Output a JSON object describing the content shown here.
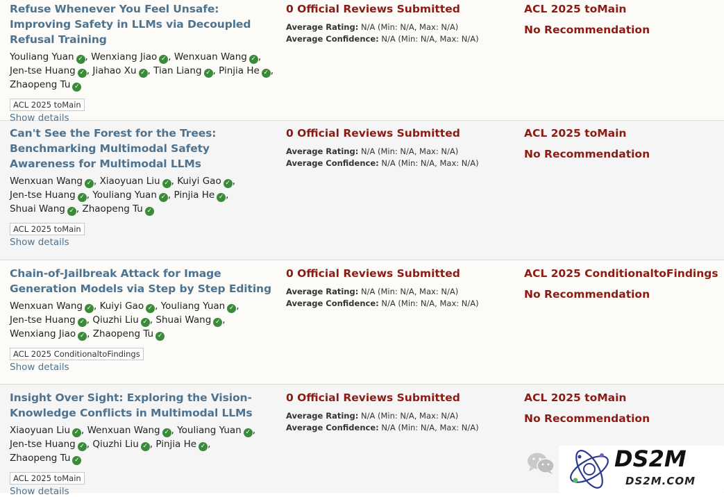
{
  "papers": [
    {
      "title": "Refuse Whenever You Feel Unsafe: Improving Safety in LLMs via Decoupled Refusal Training",
      "authors": [
        "Youliang Yuan",
        "Wenxiang Jiao",
        "Wenxuan Wang",
        "Jen-tse Huang",
        "Jiahao Xu",
        "Tian Liang",
        "Pinjia He",
        "Zhaopeng Tu"
      ],
      "venue_tag": "ACL 2025 toMain",
      "show_details": "Show details",
      "reviews_head": "0 Official Reviews Submitted",
      "rating_label": "Average Rating:",
      "rating_value": "N/A (Min: N/A, Max: N/A)",
      "confidence_label": "Average Confidence:",
      "confidence_value": "N/A (Min: N/A, Max: N/A)",
      "venue_decision": "ACL 2025 toMain",
      "recommendation": "No Recommendation"
    },
    {
      "title": "Can't See the Forest for the Trees: Benchmarking Multimodal Safety Awareness for Multimodal LLMs",
      "authors": [
        "Wenxuan Wang",
        "Xiaoyuan Liu",
        "Kuiyi Gao",
        "Jen-tse Huang",
        "Youliang Yuan",
        "Pinjia He",
        "Shuai Wang",
        "Zhaopeng Tu"
      ],
      "venue_tag": "ACL 2025 toMain",
      "show_details": "Show details",
      "reviews_head": "0 Official Reviews Submitted",
      "rating_label": "Average Rating:",
      "rating_value": "N/A (Min: N/A, Max: N/A)",
      "confidence_label": "Average Confidence:",
      "confidence_value": "N/A (Min: N/A, Max: N/A)",
      "venue_decision": "ACL 2025 toMain",
      "recommendation": "No Recommendation"
    },
    {
      "title": "Chain-of-Jailbreak Attack for Image Generation Models via Step by Step Editing",
      "authors": [
        "Wenxuan Wang",
        "Kuiyi Gao",
        "Youliang Yuan",
        "Jen-tse Huang",
        "Qiuzhi Liu",
        "Shuai Wang",
        "Wenxiang Jiao",
        "Zhaopeng Tu"
      ],
      "venue_tag": "ACL 2025 ConditionaltoFindings",
      "show_details": "Show details",
      "reviews_head": "0 Official Reviews Submitted",
      "rating_label": "Average Rating:",
      "rating_value": "N/A (Min: N/A, Max: N/A)",
      "confidence_label": "Average Confidence:",
      "confidence_value": "N/A (Min: N/A, Max: N/A)",
      "venue_decision": "ACL 2025 ConditionaltoFindings",
      "recommendation": "No Recommendation"
    },
    {
      "title": "Insight Over Sight: Exploring the Vision-Knowledge Conflicts in Multimodal LLMs",
      "authors": [
        "Xiaoyuan Liu",
        "Wenxuan Wang",
        "Youliang Yuan",
        "Jen-tse Huang",
        "Qiuzhi Liu",
        "Pinjia He",
        "Zhaopeng Tu"
      ],
      "venue_tag": "ACL 2025 toMain",
      "show_details": "Show details",
      "reviews_head": "0 Official Reviews Submitted",
      "rating_label": "Average Rating:",
      "rating_value": "N/A (Min: N/A, Max: N/A)",
      "confidence_label": "Average Confidence:",
      "confidence_value": "N/A (Min: N/A, Max: N/A)",
      "venue_decision": "ACL 2025 toMain",
      "recommendation": "No Recommendation"
    }
  ],
  "watermark": {
    "brand": "DS2M",
    "domain": "DS2M.COM"
  },
  "colors": {
    "title": "#4d7390",
    "decision": "#8c1b13",
    "verified": "#3a8a3a"
  }
}
